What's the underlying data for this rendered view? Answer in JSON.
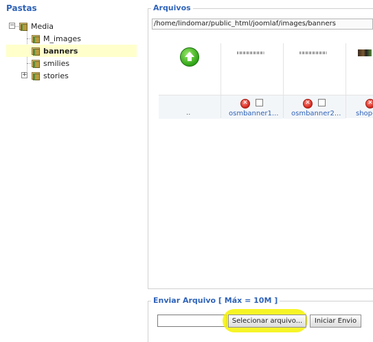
{
  "sidebar": {
    "title": "Pastas",
    "tree": [
      {
        "label": "Media",
        "expander": "−",
        "selected": false
      },
      {
        "label": "M_images",
        "expander": "",
        "selected": false
      },
      {
        "label": "banners",
        "expander": "",
        "selected": true
      },
      {
        "label": "smilies",
        "expander": "",
        "selected": false
      },
      {
        "label": "stories",
        "expander": "+",
        "selected": false
      }
    ]
  },
  "files": {
    "legend": "Arquivos",
    "path": "/home/lindomar/public_html/joomlaf/images/banners",
    "parent_label": "..",
    "items": [
      {
        "name": "osmbanner1...",
        "delete_icon": "✕"
      },
      {
        "name": "osmbanner2...",
        "delete_icon": "✕"
      },
      {
        "name": "shop-",
        "delete_icon": "✕"
      }
    ]
  },
  "upload": {
    "legend": "Enviar Arquivo [ Máx = 10M ]",
    "input_value": "",
    "select_button": "Selecionar arquivo...",
    "send_button": "Iniciar Envio"
  },
  "colors": {
    "title_blue": "#2f63b8",
    "selected_bg": "#ffffcc",
    "highlight": "#f4f200"
  }
}
